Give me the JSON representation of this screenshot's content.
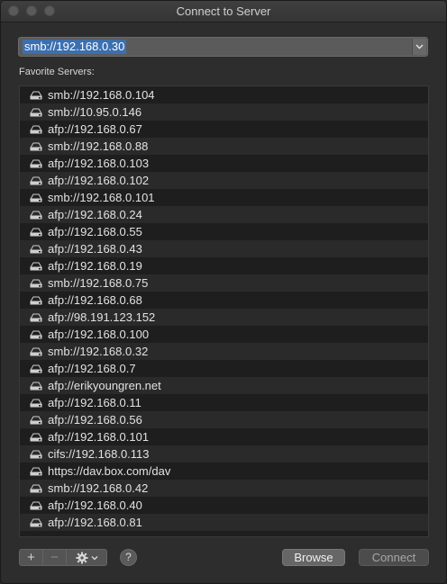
{
  "window": {
    "title": "Connect to Server"
  },
  "address": {
    "value": "smb://192.168.0.30"
  },
  "favorites": {
    "label": "Favorite Servers:",
    "servers": [
      "smb://192.168.0.104",
      "smb://10.95.0.146",
      "afp://192.168.0.67",
      "smb://192.168.0.88",
      "afp://192.168.0.103",
      "afp://192.168.0.102",
      "smb://192.168.0.101",
      "afp://192.168.0.24",
      "afp://192.168.0.55",
      "afp://192.168.0.43",
      "afp://192.168.0.19",
      "smb://192.168.0.75",
      "afp://192.168.0.68",
      "afp://98.191.123.152",
      "afp://192.168.0.100",
      "smb://192.168.0.32",
      "afp://192.168.0.7",
      "afp://erikyoungren.net",
      "afp://192.168.0.11",
      "afp://192.168.0.56",
      "afp://192.168.0.101",
      "cifs://192.168.0.113",
      "https://dav.box.com/dav",
      "smb://192.168.0.42",
      "afp://192.168.0.40",
      "afp://192.168.0.81"
    ]
  },
  "toolbar": {
    "add_label": "+",
    "remove_label": "−",
    "help_label": "?",
    "icons": [
      "plus-icon",
      "minus-icon",
      "gear-icon",
      "chevron-down-icon",
      "help-icon"
    ]
  },
  "buttons": {
    "browse": "Browse",
    "connect": "Connect"
  },
  "colors": {
    "selection": "#3c6fb0",
    "background": "#2d2d2d",
    "list_row_alt": "#2a2a2a"
  }
}
